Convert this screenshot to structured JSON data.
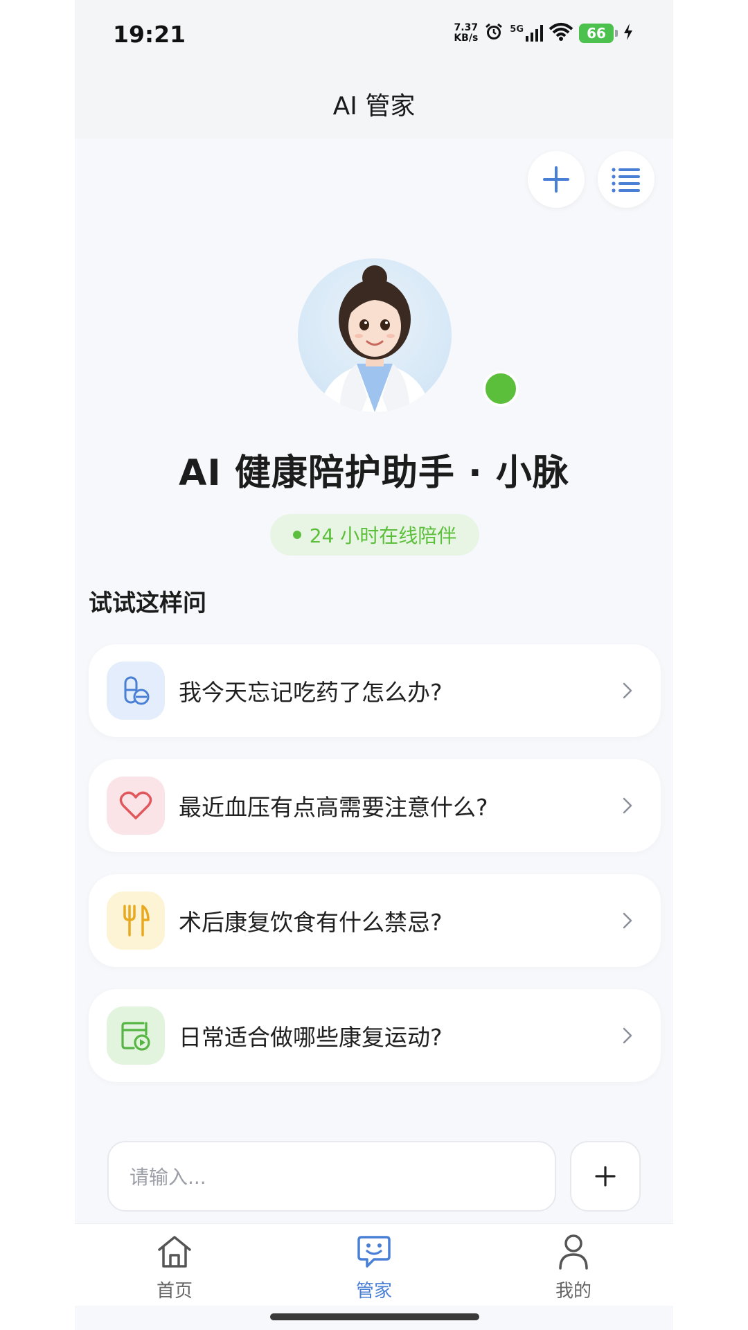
{
  "status_bar": {
    "time": "19:21",
    "net_speed_value": "7.37",
    "net_speed_unit": "KB/s",
    "network": "5G",
    "battery": "66",
    "icons": [
      "alarm-icon",
      "signal-icon",
      "wifi-icon",
      "battery-icon",
      "charging-icon"
    ]
  },
  "header": {
    "title": "AI 管家"
  },
  "assistant": {
    "name": "AI 健康陪护助手 · 小脉",
    "status_text": "24 小时在线陪伴",
    "status_color": "#5cbf3c"
  },
  "suggestions": {
    "title": "试试这样问",
    "items": [
      {
        "text": "我今天忘记吃药了怎么办?",
        "icon": "pill-icon",
        "icon_bg": "#e3edfb",
        "icon_color": "#4a7fd6"
      },
      {
        "text": "最近血压有点高需要注意什么?",
        "icon": "heart-icon",
        "icon_bg": "#fbe4e8",
        "icon_color": "#e0575c"
      },
      {
        "text": "术后康复饮食有什么禁忌?",
        "icon": "fork-knife-icon",
        "icon_bg": "#fdf4d6",
        "icon_color": "#e8a91f"
      },
      {
        "text": "日常适合做哪些康复运动?",
        "icon": "exercise-video-icon",
        "icon_bg": "#e2f4dd",
        "icon_color": "#56b544"
      }
    ]
  },
  "input": {
    "placeholder": "请输入..."
  },
  "tab_bar": {
    "items": [
      {
        "label": "首页",
        "icon": "home-icon",
        "active": false
      },
      {
        "label": "管家",
        "icon": "chat-assistant-icon",
        "active": true
      },
      {
        "label": "我的",
        "icon": "profile-icon",
        "active": false
      }
    ]
  },
  "colors": {
    "accent": "#4a7fd6",
    "background": "#f7f8fb"
  }
}
